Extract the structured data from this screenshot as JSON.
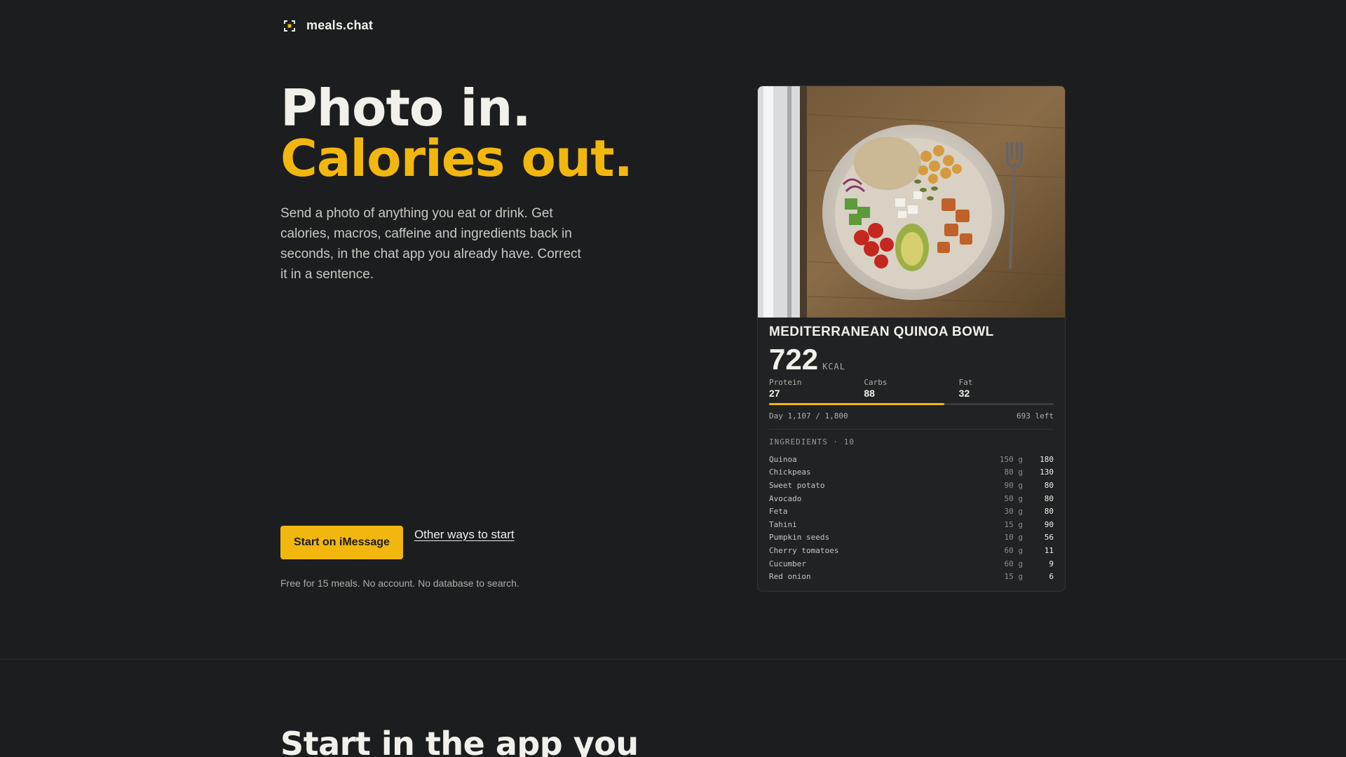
{
  "header": {
    "brand": "meals.chat",
    "brand_icon": "scan-frame-icon"
  },
  "hero": {
    "title_line1": "Photo in.",
    "title_line2": "Calories out.",
    "description": "Send a photo of anything you eat or drink. Get calories, macros, caffeine and ingredients back in seconds, in the chat app you already have. Correct it in a sentence.",
    "cta_primary": "Start on iMessage",
    "cta_secondary": "Other ways to start",
    "note": "Free for 15 meals. No account. No database to search."
  },
  "colors": {
    "accent": "#f2b70f",
    "background": "#1c1d1f",
    "card": "#212224"
  },
  "meal_card": {
    "photo_alt": "Mediterranean quinoa bowl photo",
    "name": "MEDITERRANEAN QUINOA BOWL",
    "kcal": "722",
    "kcal_unit": "KCAL",
    "macros": [
      {
        "label": "Protein",
        "value": "27"
      },
      {
        "label": "Carbs",
        "value": "88"
      },
      {
        "label": "Fat",
        "value": "32"
      }
    ],
    "day_progress_fraction": 0.615,
    "day_total": "Day 1,107 / 1,800",
    "day_left": "693 left",
    "ingredients_title": "INGREDIENTS · 10",
    "ingredients": [
      {
        "name": "Quinoa",
        "qty": "150 g",
        "kcal": "180"
      },
      {
        "name": "Chickpeas",
        "qty": "80 g",
        "kcal": "130"
      },
      {
        "name": "Sweet potato",
        "qty": "90 g",
        "kcal": "80"
      },
      {
        "name": "Avocado",
        "qty": "50 g",
        "kcal": "80"
      },
      {
        "name": "Feta",
        "qty": "30 g",
        "kcal": "80"
      },
      {
        "name": "Tahini",
        "qty": "15 g",
        "kcal": "90"
      },
      {
        "name": "Pumpkin seeds",
        "qty": "10 g",
        "kcal": "56"
      },
      {
        "name": "Cherry tomatoes",
        "qty": "60 g",
        "kcal": "11"
      },
      {
        "name": "Cucumber",
        "qty": "60 g",
        "kcal": "9"
      },
      {
        "name": "Red onion",
        "qty": "15 g",
        "kcal": "6"
      }
    ]
  },
  "section2": {
    "title": "Start in the app you"
  }
}
